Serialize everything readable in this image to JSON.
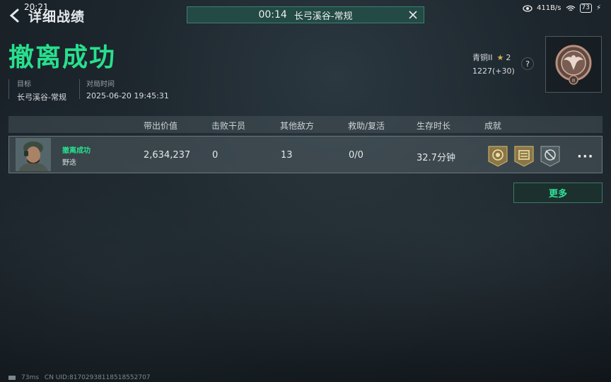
{
  "status_bar": {
    "time": "20:21",
    "net_speed": "411B/s",
    "battery": "73"
  },
  "header": {
    "title": "详细战绩"
  },
  "match_banner": {
    "time": "00:14",
    "map": "长弓溪谷-常规"
  },
  "result": {
    "title": "撤离成功"
  },
  "info": {
    "target_label": "目标",
    "target_value": "长弓溪谷-常规",
    "time_label": "对局时间",
    "time_value": "2025-06-20 19:45:31"
  },
  "rank": {
    "name": "青铜II",
    "stars": "2",
    "score": "1227(+30)",
    "help": "?"
  },
  "table": {
    "headers": [
      "带出价值",
      "击败干员",
      "其他敌方",
      "救助/复活",
      "生存时长",
      "成就"
    ],
    "row": {
      "status": "撤离成功",
      "name": "野迭",
      "value": "2,634,237",
      "kills": "0",
      "others": "13",
      "assist": "0/0",
      "survival": "32.7分钟",
      "more": "···"
    }
  },
  "more_button": "更多",
  "footer": {
    "ping": "73ms",
    "uid": "CN UID:817029381185185527​07"
  },
  "colors": {
    "accent": "#27e08e",
    "banner": "#234a45",
    "gold": "#d6b458"
  },
  "icons": [
    "back-arrow-icon",
    "close-icon",
    "eye-icon",
    "wifi-icon",
    "battery-icon",
    "star-icon",
    "help-icon",
    "rank-badge-icon",
    "medal-icon",
    "more-icon"
  ]
}
